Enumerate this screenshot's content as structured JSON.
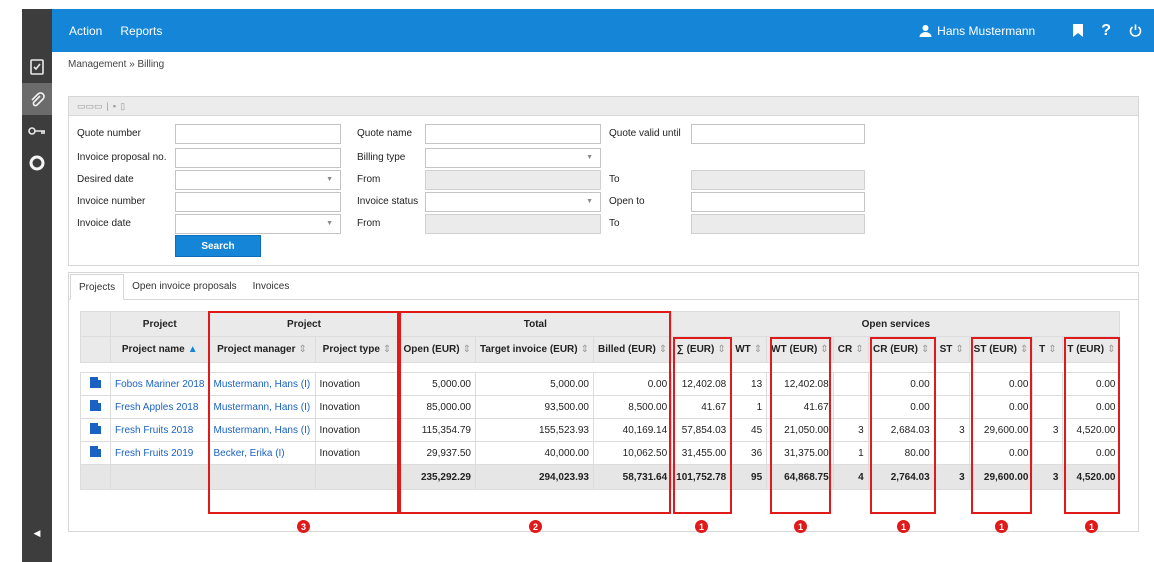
{
  "topbar": {
    "menu": [
      "Action",
      "Reports"
    ],
    "user_name": "Hans Mustermann"
  },
  "breadcrumb": "Management  »  Billing",
  "filters": {
    "quote_number": "Quote number",
    "invoice_proposal_no": "Invoice proposal no.",
    "desired_date": "Desired date",
    "invoice_number": "Invoice number",
    "invoice_date": "Invoice date",
    "quote_name": "Quote name",
    "billing_type": "Billing type",
    "from1": "From",
    "invoice_status": "Invoice status",
    "from2": "From",
    "quote_valid_until": "Quote valid until",
    "to1": "To",
    "open_to": "Open to",
    "to2": "To",
    "search_button": "Search"
  },
  "tabs": [
    "Projects",
    "Open invoice proposals",
    "Invoices"
  ],
  "table": {
    "group_headers": {
      "project": "Project",
      "project2": "Project",
      "total": "Total",
      "open_services": "Open services"
    },
    "columns": {
      "project_name": "Project name",
      "project_manager": "Project manager",
      "project_type": "Project type",
      "open_eur": "Open (EUR)",
      "target_invoice_eur": "Target invoice (EUR)",
      "billed_eur": "Billed (EUR)",
      "sum_eur": "∑ (EUR)",
      "wt": "WT",
      "wt_eur": "WT (EUR)",
      "cr": "CR",
      "cr_eur": "CR (EUR)",
      "st": "ST",
      "st_eur": "ST (EUR)",
      "t": "T",
      "t_eur": "T (EUR)"
    },
    "rows": [
      {
        "name": "Fobos Mariner 2018",
        "manager": "Mustermann, Hans (I)",
        "type": "Inovation",
        "open": "5,000.00",
        "target": "5,000.00",
        "billed": "0.00",
        "sum": "12,402.08",
        "wt": "13",
        "wt_eur": "12,402.08",
        "cr": "",
        "cr_eur": "0.00",
        "st": "",
        "st_eur": "0.00",
        "t": "",
        "t_eur": "0.00"
      },
      {
        "name": "Fresh Apples 2018",
        "manager": "Mustermann, Hans (I)",
        "type": "Inovation",
        "open": "85,000.00",
        "target": "93,500.00",
        "billed": "8,500.00",
        "sum": "41.67",
        "wt": "1",
        "wt_eur": "41.67",
        "cr": "",
        "cr_eur": "0.00",
        "st": "",
        "st_eur": "0.00",
        "t": "",
        "t_eur": "0.00"
      },
      {
        "name": "Fresh Fruits 2018",
        "manager": "Mustermann, Hans (I)",
        "type": "Inovation",
        "open": "115,354.79",
        "target": "155,523.93",
        "billed": "40,169.14",
        "sum": "57,854.03",
        "wt": "45",
        "wt_eur": "21,050.00",
        "cr": "3",
        "cr_eur": "2,684.03",
        "st": "3",
        "st_eur": "29,600.00",
        "t": "3",
        "t_eur": "4,520.00"
      },
      {
        "name": "Fresh Fruits 2019",
        "manager": "Becker, Erika (I)",
        "type": "Inovation",
        "open": "29,937.50",
        "target": "40,000.00",
        "billed": "10,062.50",
        "sum": "31,455.00",
        "wt": "36",
        "wt_eur": "31,375.00",
        "cr": "1",
        "cr_eur": "80.00",
        "st": "",
        "st_eur": "0.00",
        "t": "",
        "t_eur": "0.00"
      }
    ],
    "totals": {
      "open": "235,292.29",
      "target": "294,023.93",
      "billed": "58,731.64",
      "sum": "101,752.78",
      "wt": "95",
      "wt_eur": "64,868.75",
      "cr": "4",
      "cr_eur": "2,764.03",
      "st": "3",
      "st_eur": "29,600.00",
      "t": "3",
      "t_eur": "4,520.00"
    }
  },
  "annotations": {
    "m1": "1",
    "m2": "2",
    "m3": "3",
    "m4": "1",
    "m5": "1",
    "m6": "1",
    "m7": "1"
  },
  "colors": {
    "primary": "#1585d8",
    "annotation": "#e01a1a",
    "sidebar": "#3d3d3d"
  }
}
